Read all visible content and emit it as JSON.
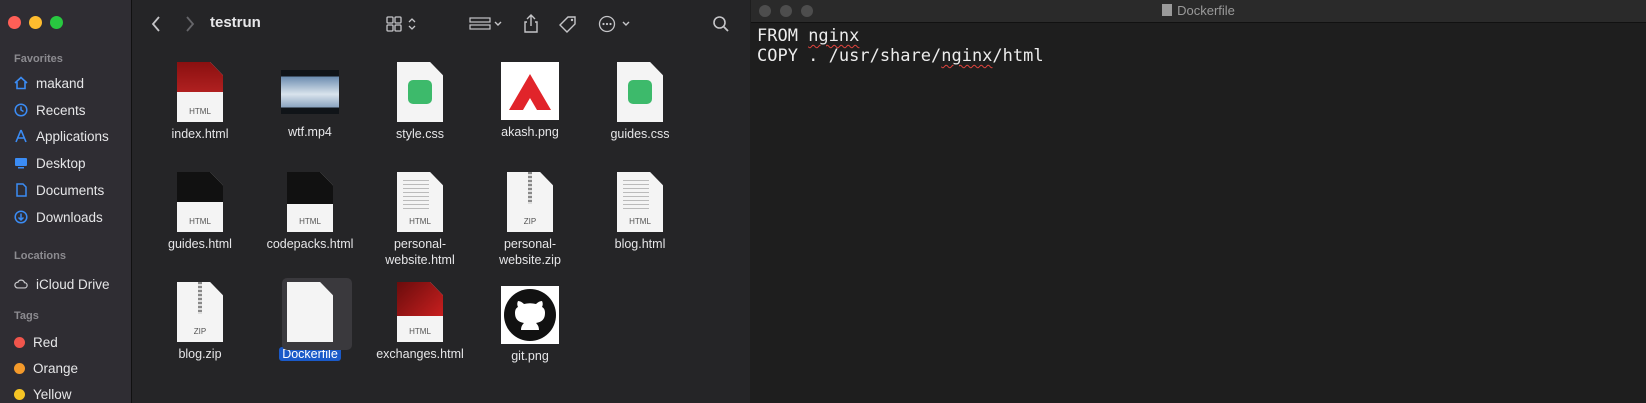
{
  "finder": {
    "title": "testrun",
    "sidebar": {
      "favorites_header": "Favorites",
      "favorites": [
        {
          "label": "makand",
          "icon": "home-icon"
        },
        {
          "label": "Recents",
          "icon": "clock-icon"
        },
        {
          "label": "Applications",
          "icon": "applications-icon"
        },
        {
          "label": "Desktop",
          "icon": "desktop-icon"
        },
        {
          "label": "Documents",
          "icon": "document-icon"
        },
        {
          "label": "Downloads",
          "icon": "download-icon"
        }
      ],
      "locations_header": "Locations",
      "locations": [
        {
          "label": "iCloud Drive",
          "icon": "cloud-icon"
        }
      ],
      "tags_header": "Tags",
      "tags": [
        {
          "label": "Red",
          "color": "#f0554c"
        },
        {
          "label": "Orange",
          "color": "#f49a2b"
        },
        {
          "label": "Yellow",
          "color": "#f5c425"
        }
      ]
    },
    "files": [
      {
        "name": "index.html",
        "kind": "HTML"
      },
      {
        "name": "wtf.mp4",
        "kind": "video"
      },
      {
        "name": "style.css",
        "kind": "css"
      },
      {
        "name": "akash.png",
        "kind": "png"
      },
      {
        "name": "guides.css",
        "kind": "css"
      },
      {
        "name": "guides.html",
        "kind": "HTML"
      },
      {
        "name": "codepacks.html",
        "kind": "HTML"
      },
      {
        "name": "personal-\nwebsite.html",
        "kind": "HTML"
      },
      {
        "name": "personal-\nwebsite.zip",
        "kind": "ZIP"
      },
      {
        "name": "blog.html",
        "kind": "HTML"
      },
      {
        "name": "blog.zip",
        "kind": "ZIP"
      },
      {
        "name": "Dockerfile",
        "kind": "blank",
        "selected": true
      },
      {
        "name": "exchanges.html",
        "kind": "HTML"
      },
      {
        "name": "git.png",
        "kind": "github"
      }
    ]
  },
  "editor": {
    "title": "Dockerfile",
    "lines": [
      {
        "pre": "FROM ",
        "err": "nginx",
        "post": ""
      },
      {
        "pre": "COPY . /usr/share/",
        "err": "nginx",
        "post": "/html"
      }
    ]
  }
}
